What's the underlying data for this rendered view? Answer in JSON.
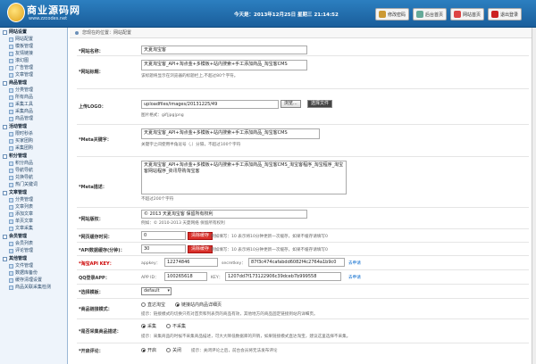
{
  "header": {
    "logo_main": "商业源码网",
    "logo_sub": "www.zzcodes.net",
    "datetime": "今天是：2013年12月25日 星期三 21:14:52",
    "buttons": [
      {
        "label": "修改密码",
        "color": "#c93"
      },
      {
        "label": "后台首页",
        "color": "#6a9"
      },
      {
        "label": "网站首页",
        "color": "#d44"
      },
      {
        "label": "退出登录",
        "color": "#c22"
      }
    ]
  },
  "sidebar": {
    "sections": [
      {
        "title": "网站设置",
        "items": [
          "网站配置",
          "模板管理",
          "友情链接",
          "滚幻图",
          "广告管理",
          "文章管理"
        ]
      },
      {
        "title": "商品管理",
        "items": [
          "分类管理",
          "所有商品",
          "采集工具",
          "采集商品",
          "商品管理"
        ]
      },
      {
        "title": "活动管理",
        "items": [
          "限时秒杀",
          "买家团购",
          "采集团购"
        ]
      },
      {
        "title": "积分管理",
        "items": [
          "积分商品",
          "导航导航",
          "兑换导航",
          "热门关键词"
        ]
      },
      {
        "title": "文章管理",
        "items": [
          "分类管理",
          "文章列表",
          "添加文章",
          "单页文章",
          "文章采集"
        ]
      },
      {
        "title": "会员管理",
        "items": [
          "会员列表",
          "评论管理"
        ]
      },
      {
        "title": "其他管理",
        "items": [
          "文件管理",
          "数据库备份",
          "缓存清理设置",
          "商品关联采集检测"
        ]
      }
    ]
  },
  "breadcrumb": "您现在的位置：网站配置",
  "form": {
    "site_name": {
      "label": "*网站名称：",
      "value": "天夏淘宝客"
    },
    "site_title": {
      "label": "*网站标题：",
      "value": "天夏淘宝客_API+淘点金+多模板+站内搜索+手工添加商品_淘宝客CMS",
      "hint": "该标题将显示在浏览器的标题栏上,不超过80个字符。"
    },
    "logo": {
      "label": "上传LOGO：",
      "value": "uploadfiles/images/20131225/49",
      "browse": "浏览...",
      "choose": "选择文件",
      "hint": "图片格式：gif|jpg|png"
    },
    "keywords": {
      "label": "*Meta关键字：",
      "value": "天夏淘宝客_API+淘点金+多模板+站内搜索+手工添加商品_淘宝客CMS",
      "hint": "关键字之间使用半角逗号（,）分隔，不超过100个字符"
    },
    "desc": {
      "label": "*Meta描述：",
      "value": "天夏淘宝客_API+淘点金+多模板+站内搜索+手工添加商品_淘宝客CMS_淘宝客程序_淘宝程序_淘宝客网站程序_资讯导购淘宝客",
      "hint": "不超过200个字符"
    },
    "copyright": {
      "label": "*网站版权：",
      "value": "© 2013 天夏淘宝客 保留所有权利",
      "hint": "例如：© 2010-2013 天夏网络 保留所有权利"
    },
    "cache": {
      "label": "*网页缓存时间：",
      "value": "0",
      "btn": "清除缓存",
      "hint": "例如填写：10 表示将10分钟更新一次缓存，如果不缓存请填写0"
    },
    "api_cache": {
      "label": "*API数据缓存(分钟)：",
      "value": "30",
      "btn": "清除缓存",
      "hint": "例如填写：10 表示将10分钟更新一次缓存，如果不缓存请填写0"
    },
    "taobao_api": {
      "label": "*淘宝API KEY：",
      "appkey_label": "appkey：",
      "appkey": "12274846",
      "secret_label": "secretkey：",
      "secret": "87f3c474cafabdd6082f4c2764a1b9c0",
      "apply": "去申请"
    },
    "qq_app": {
      "label": "QQ登录APP：",
      "appid_label": "APP ID：",
      "appid": "100265618",
      "key_label": "KEY：",
      "key": "1207dd7f173122906c39dceb7b999558",
      "apply": "去申请"
    },
    "template": {
      "label": "*选择模板：",
      "value": "default"
    },
    "detail": {
      "label": "*商品链接模式：",
      "opt1": "直达淘宝",
      "opt2": "链接站内商品详细页",
      "hint": "提示：链接模式的切换只有对首页和列表页的商品有效，其他地方的商品固定链接到站内详细页。"
    },
    "collect": {
      "label": "*是否采集商品描述：",
      "opt1": "采集",
      "opt2": "不采集",
      "hint": "提示：采集商品的时候不采集商品描述，可大大降低数据库的开销，如果链接模式直达淘宝，建议这里选择不采集。"
    },
    "comment": {
      "label": "*开启评论：",
      "opt1": "开启",
      "opt2": "关闭",
      "hint": "提示：关闭评论之后，前台会员将无法发布评论"
    }
  }
}
